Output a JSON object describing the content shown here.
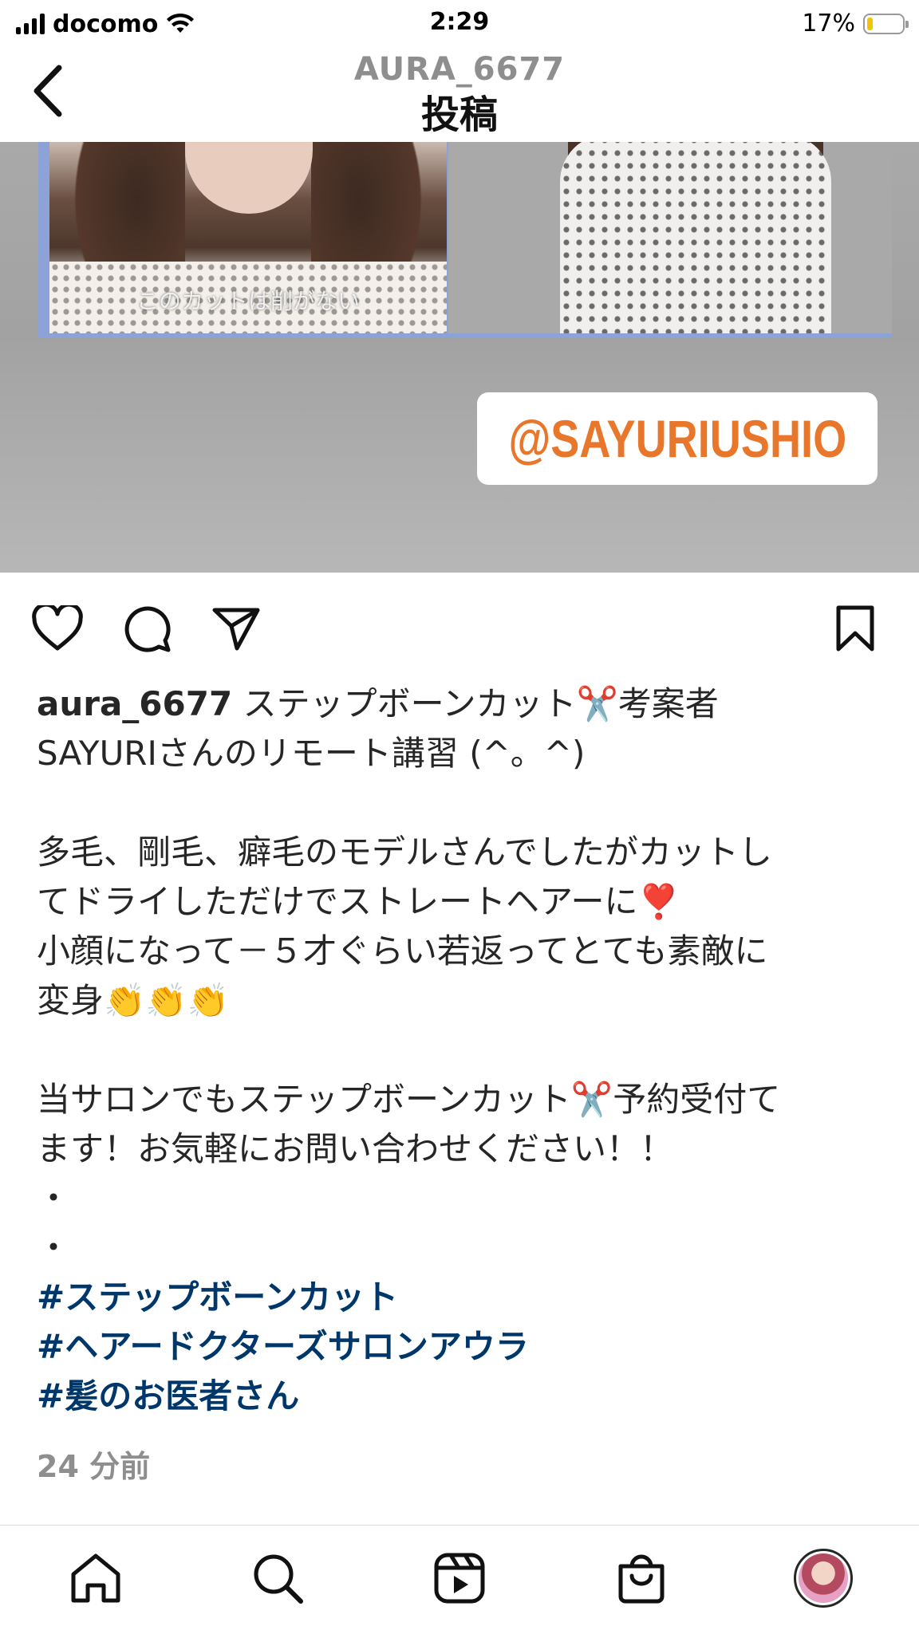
{
  "status_bar": {
    "carrier": "docomo",
    "time": "2:29",
    "battery_percent": "17%",
    "battery_level": 0.17
  },
  "header": {
    "username": "AURA_6677",
    "title": "投稿"
  },
  "post": {
    "image_caption": "このカットは削がない",
    "tag_text": "@SAYURIUSHIO",
    "caption": {
      "username": "aura_6677",
      "lines": [
        "ステップボーンカット✂️考案者",
        "SAYURIさんのリモート講習 (^。^)",
        "多毛、剛毛、癖毛のモデルさんでしたがカットし",
        "てドライしただけでストレートヘアーに❣️",
        "小顔になって－５才ぐらい若返ってとても素敵に",
        "変身👏👏👏",
        "当サロンでもステップボーンカット✂️予約受付て",
        "ます！お気軽にお問い合わせください！！",
        "・",
        "・"
      ],
      "hashtags": [
        "#ステップボーンカット",
        "#ヘアードクターズサロンアウラ",
        "#髪のお医者さん"
      ]
    },
    "timestamp": "24 分前"
  },
  "icons": {
    "back": "chevron-left-icon",
    "like": "heart-icon",
    "comment": "comment-icon",
    "share": "paper-plane-icon",
    "save": "bookmark-icon",
    "home": "home-icon",
    "search": "search-icon",
    "reels": "reels-icon",
    "shop": "shopping-bag-icon",
    "profile": "avatar"
  },
  "colors": {
    "hashtag": "#00376b",
    "tag_text": "#e8772b",
    "muted": "#8e8e8e"
  }
}
